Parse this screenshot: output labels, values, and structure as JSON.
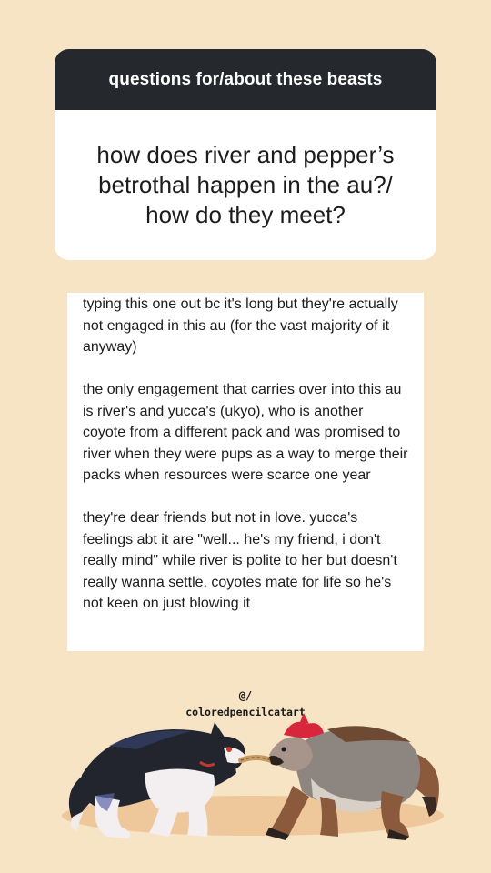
{
  "question_card": {
    "header": "questions for/about these beasts",
    "question": "how does river and pepper’s betrothal happen in the au?/ how do they meet?"
  },
  "answer": {
    "paragraphs": [
      "typing this one out bc it's long but they're actually not engaged in this au (for the vast majority of it anyway)",
      "the only engagement that carries over into this au is river's and yucca's (ukyo), who is another coyote from a different pack and was promised to river when they were pups as a way to merge their packs when resources were scarce one year",
      "they're dear friends but not in love. yucca's feelings abt it are \"well... he's my friend, i don't really mind\" while river is polite to her but doesn't really wanna settle. coyotes mate for life so he's not keen on just blowing it"
    ]
  },
  "credit": {
    "at": "@/",
    "username": "coloredpencilcatart"
  },
  "illustration": {
    "subject": "two-canines-tug-of-war-icon"
  },
  "colors": {
    "background": "#f6e4c4",
    "card_header": "#25282c",
    "card_body": "#ffffff",
    "text": "#1c1c1c"
  }
}
